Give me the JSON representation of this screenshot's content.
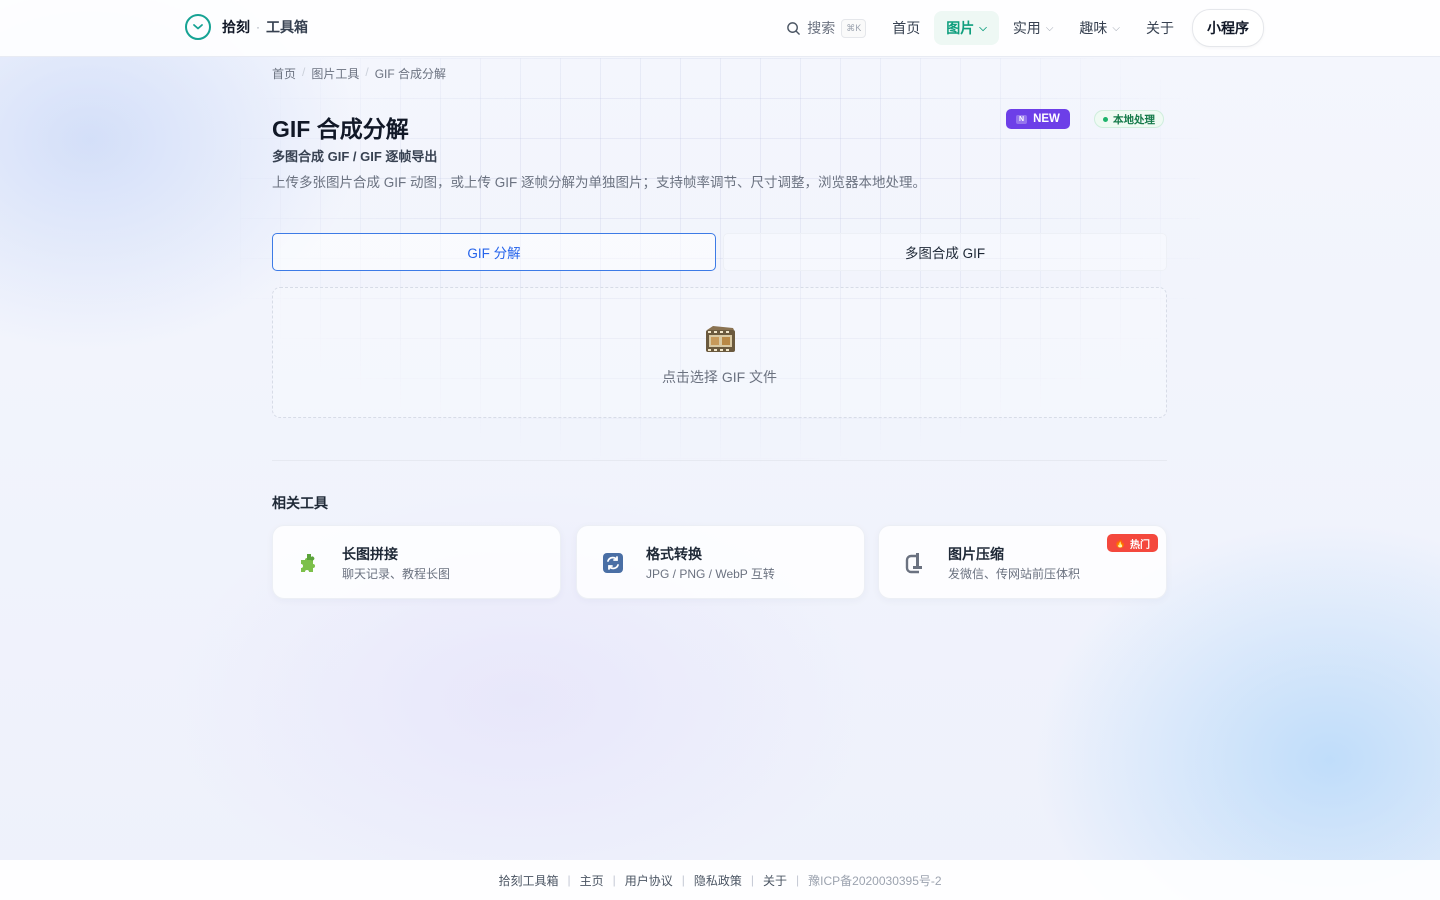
{
  "header": {
    "logo_name": "拾刻",
    "logo_dot": "·",
    "logo_sub": "工具箱",
    "search_label": "搜索",
    "search_kbd": "⌘K",
    "nav": [
      {
        "label": "首页",
        "has_menu": false
      },
      {
        "label": "图片",
        "has_menu": true,
        "active": true
      },
      {
        "label": "实用",
        "has_menu": true
      },
      {
        "label": "趣味",
        "has_menu": true
      },
      {
        "label": "关于",
        "has_menu": false
      }
    ],
    "mini_program": "小程序"
  },
  "breadcrumb": [
    "首页",
    "图片工具",
    "GIF 合成分解"
  ],
  "page": {
    "title": "GIF 合成分解",
    "subtitle": "多图合成 GIF / GIF 逐帧导出",
    "description": "上传多张图片合成 GIF 动图，或上传 GIF 逐帧分解为单独图片；支持帧率调节、尺寸调整，浏览器本地处理。",
    "badge_new": "NEW",
    "badge_new_mark": "N",
    "badge_local": "本地处理"
  },
  "tabs": [
    {
      "label": "GIF 分解",
      "active": true
    },
    {
      "label": "多图合成 GIF",
      "active": false
    }
  ],
  "dropzone": {
    "text": "点击选择 GIF 文件",
    "icon": "film-icon"
  },
  "related": {
    "title": "相关工具",
    "items": [
      {
        "name": "长图拼接",
        "desc": "聊天记录、教程长图",
        "icon": "puzzle-icon"
      },
      {
        "name": "格式转换",
        "desc": "JPG / PNG / WebP 互转",
        "icon": "convert-icon"
      },
      {
        "name": "图片压缩",
        "desc": "发微信、传网站前压体积",
        "icon": "clamp-icon",
        "badge": "热门"
      }
    ]
  },
  "footer": {
    "links": [
      "拾刻工具箱",
      "主页",
      "用户协议",
      "隐私政策",
      "关于"
    ],
    "icp": "豫ICP备2020030395号-2"
  },
  "colors": {
    "accent": "#16a394",
    "primary_blue": "#2563eb",
    "new_badge": "#6d3fe8",
    "hot_badge": "#f4483d"
  }
}
